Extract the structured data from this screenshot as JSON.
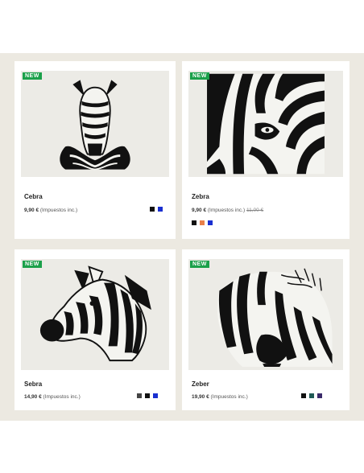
{
  "products": [
    {
      "badge": "NEW",
      "name": "Cebra",
      "price": "9,90 €",
      "tax_note": "(Impuestos inc.)",
      "old_price": "",
      "swatches": [
        "#111111",
        "#1a2fd0"
      ],
      "image": "zebra-front-head"
    },
    {
      "badge": "NEW",
      "name": "Zebra",
      "price": "9,90 €",
      "tax_note": "(Impuestos inc.)",
      "old_price": "11,00 €",
      "swatches": [
        "#111111",
        "#e8804a",
        "#1a2fd0"
      ],
      "image": "zebra-eye-closeup"
    },
    {
      "badge": "NEW",
      "name": "Sebra",
      "price": "14,90 €",
      "tax_note": "(Impuestos inc.)",
      "old_price": "",
      "swatches": [
        "#444444",
        "#111111",
        "#1a2fd0"
      ],
      "image": "zebra-side-head"
    },
    {
      "badge": "NEW",
      "name": "Zeber",
      "price": "19,90 €",
      "tax_note": "(Impuestos inc.)",
      "old_price": "",
      "swatches": [
        "#111111",
        "#1f5a55",
        "#3a2a6a"
      ],
      "image": "zebra-sketch-head"
    }
  ]
}
